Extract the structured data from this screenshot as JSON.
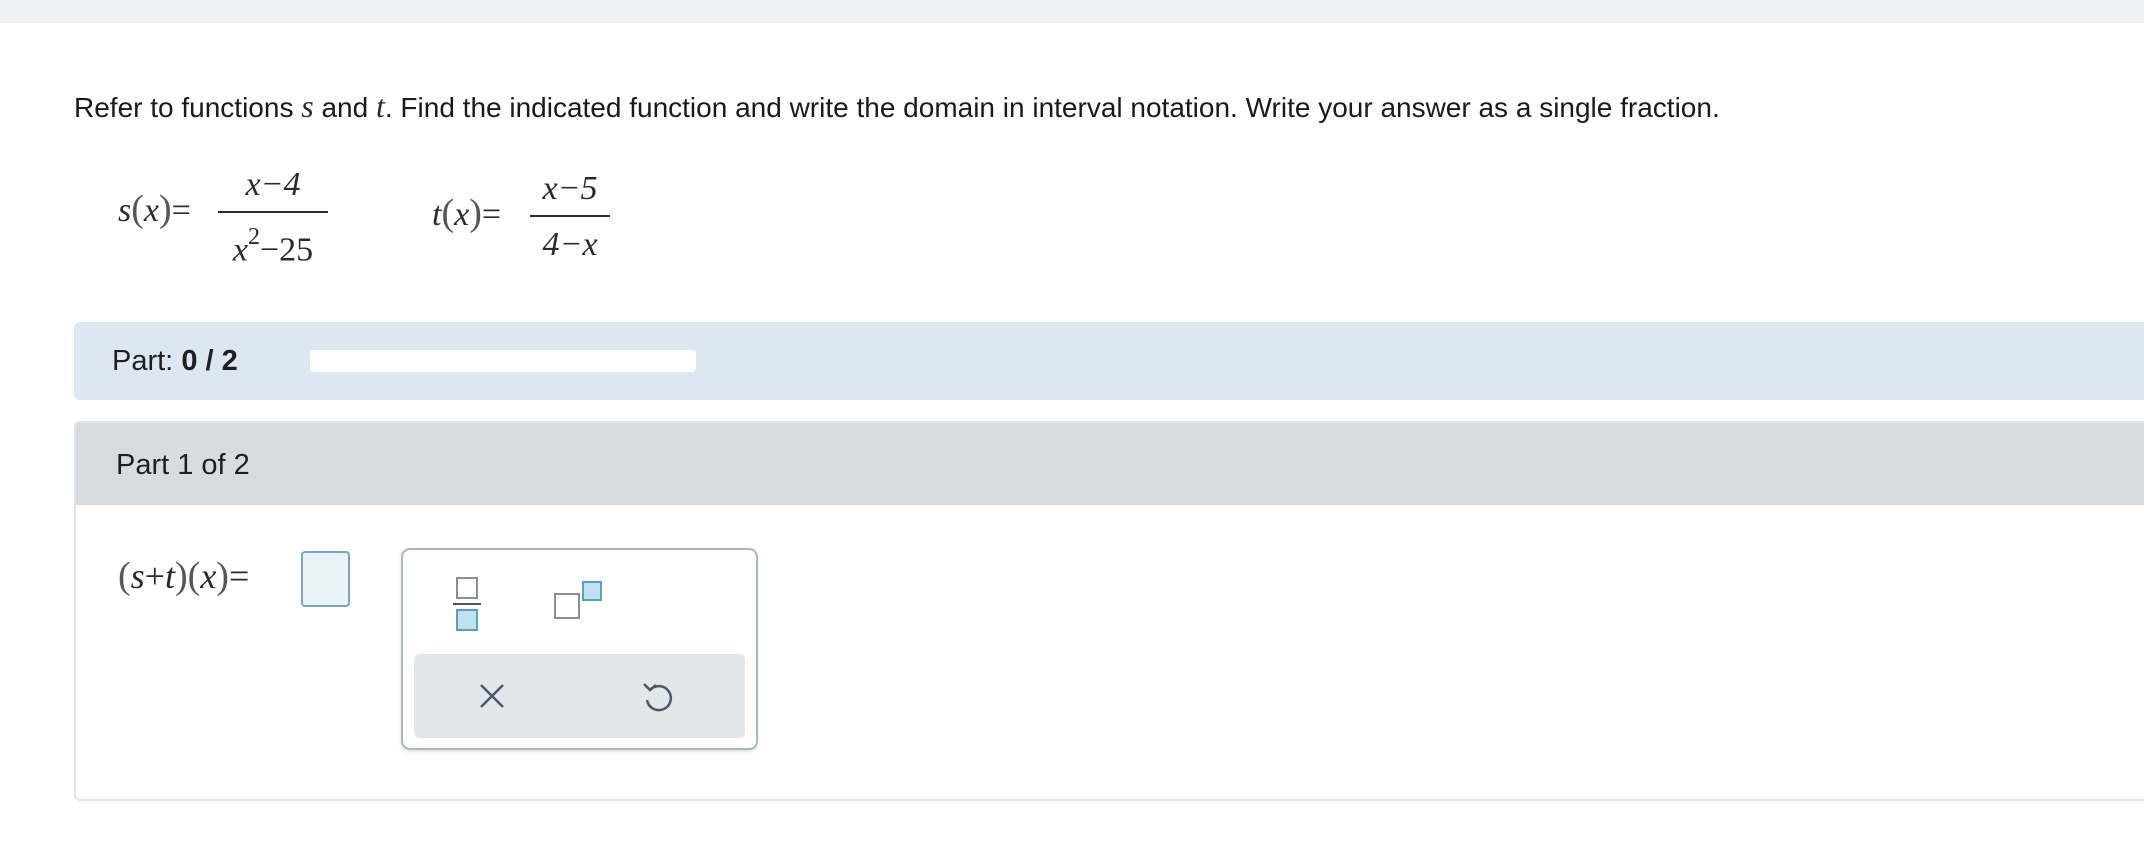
{
  "problem": {
    "intro": "Refer to functions ",
    "var_s": "s",
    "and": " and ",
    "var_t": "t",
    "rest": ". Find the indicated function and write the domain in interval notation. Write your answer as a single fraction."
  },
  "functions": {
    "s": {
      "name": "s",
      "arg": "x",
      "numerator": "x−4",
      "denominator_base": "x",
      "denominator_exp": "2",
      "denominator_rest": "−25"
    },
    "t": {
      "name": "t",
      "arg": "x",
      "numerator": "x−5",
      "denominator": "4−x"
    }
  },
  "progress": {
    "label": "Part: ",
    "value": "0 / 2",
    "fraction_complete": 0
  },
  "part": {
    "header": "Part 1 of 2",
    "answer_label": "(s+t)(x)="
  },
  "palette": {
    "buttons": [
      "fraction-icon",
      "exponent-icon",
      "clear-icon",
      "undo-icon"
    ]
  },
  "colors": {
    "part_bar_bg": "#dde7f1",
    "part_header_bg": "#d5dde1",
    "answer_box_border": "#79a7c4",
    "palette_accent": "#5b9fc0"
  }
}
